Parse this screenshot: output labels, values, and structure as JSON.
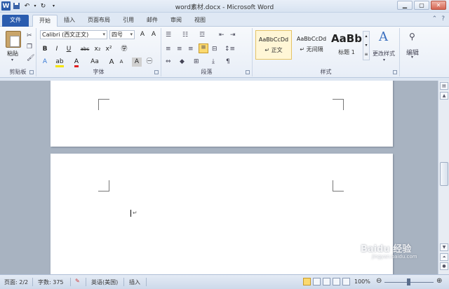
{
  "window": {
    "title": "word素材.docx - Microsoft Word",
    "app_icon": "W"
  },
  "tabs": {
    "file": "文件",
    "items": [
      "开始",
      "插入",
      "页面布局",
      "引用",
      "邮件",
      "审阅",
      "视图"
    ],
    "active": "开始"
  },
  "ribbon": {
    "clipboard": {
      "paste": "粘贴",
      "label": "剪贴板"
    },
    "font": {
      "name": "Calibri (西文正文)",
      "size": "四号",
      "label": "字体",
      "bold": "B",
      "italic": "I",
      "underline": "U",
      "strike": "abc",
      "subscript": "x₂",
      "superscript": "x²",
      "case": "Aa",
      "grow": "A",
      "shrink": "A",
      "clear": "A"
    },
    "paragraph": {
      "label": "段落"
    },
    "styles": {
      "label": "样式",
      "items": [
        {
          "sample": "AaBbCcDd",
          "name": "↵ 正文"
        },
        {
          "sample": "AaBbCcDd",
          "name": "↵ 无间隔"
        },
        {
          "sample": "AaBb",
          "name": "标题 1"
        }
      ],
      "change": "更改样式"
    },
    "editing": {
      "label": "编辑"
    }
  },
  "document": {
    "paragraph_mark": "↵"
  },
  "status": {
    "page": "页面: 2/2",
    "words": "字数: 375",
    "language": "英语(美国)",
    "mode": "插入",
    "zoom": "100%"
  },
  "watermark": {
    "text": "Baidu 经验",
    "sub": "jingyan.baidu.com"
  },
  "colors": {
    "file_tab": "#2a5caf",
    "ribbon_bg": "#e8eef7",
    "canvas_bg": "#a8b3c1"
  }
}
